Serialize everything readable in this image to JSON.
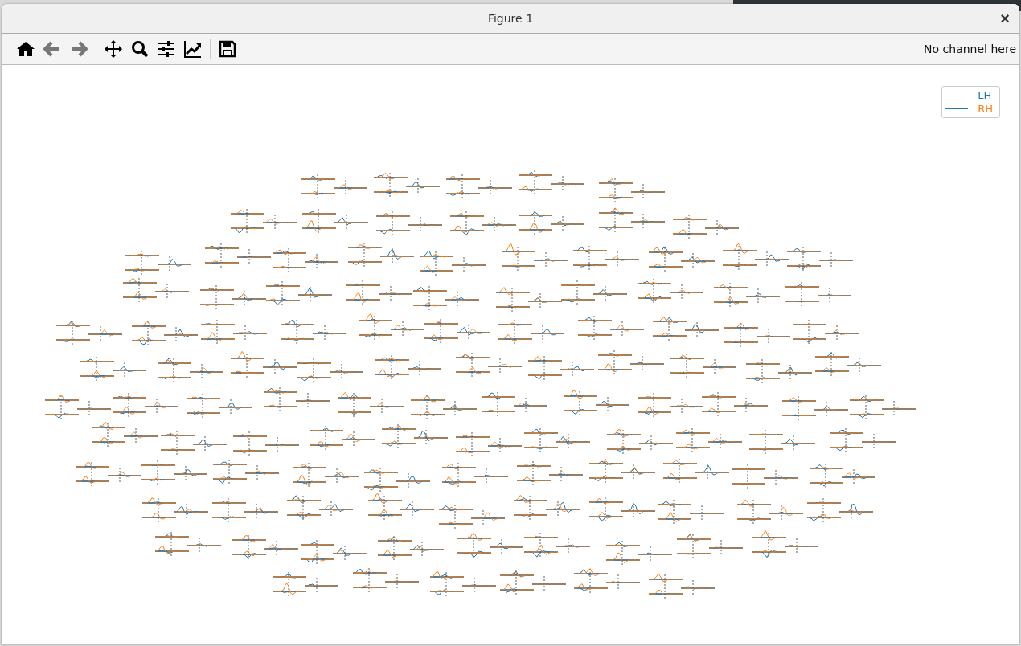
{
  "window": {
    "title": "Figure 1",
    "close": "×"
  },
  "toolbar": {
    "back_disabled": true,
    "forward_disabled": true,
    "status": "No channel here"
  },
  "legend": [
    {
      "label": "LH",
      "color": "#1f77b4",
      "line": false
    },
    {
      "label": "RH",
      "color": "#ff7f0e",
      "line": true
    }
  ]
}
